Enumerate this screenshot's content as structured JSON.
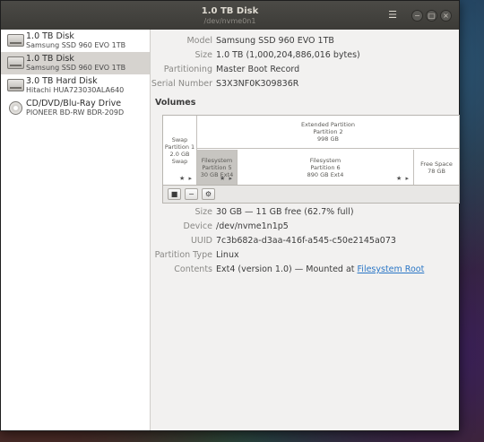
{
  "window": {
    "title": "1.0 TB Disk",
    "subtitle": "/dev/nvme0n1"
  },
  "sidebar": {
    "items": [
      {
        "name": "1.0 TB Disk",
        "sub": "Samsung SSD 960 EVO 1TB",
        "icon": "drive-icon",
        "selected": false
      },
      {
        "name": "1.0 TB Disk",
        "sub": "Samsung SSD 960 EVO 1TB",
        "icon": "drive-icon",
        "selected": true
      },
      {
        "name": "3.0 TB Hard Disk",
        "sub": "Hitachi HUA723030ALA640",
        "icon": "drive-icon",
        "selected": false
      },
      {
        "name": "CD/DVD/Blu-Ray Drive",
        "sub": "PIONEER BD-RW   BDR-209D",
        "icon": "optical-disc-icon",
        "selected": false
      }
    ]
  },
  "disk": {
    "model_label": "Model",
    "model": "Samsung SSD 960 EVO 1TB",
    "size_label": "Size",
    "size": "1.0 TB (1,000,204,886,016 bytes)",
    "partitioning_label": "Partitioning",
    "partitioning": "Master Boot Record",
    "serial_label": "Serial Number",
    "serial": "S3X3NF0K309836R"
  },
  "volumes": {
    "title": "Volumes",
    "swap": {
      "l1": "Swap",
      "l2": "Partition 1",
      "l3": "2.0 GB Swap"
    },
    "extended": {
      "l1": "Extended Partition",
      "l2": "Partition 2",
      "l3": "998 GB"
    },
    "fs5": {
      "l1": "Filesystem",
      "l2": "Partition 5",
      "l3": "30 GB Ext4"
    },
    "fs6": {
      "l1": "Filesystem",
      "l2": "Partition 6",
      "l3": "890 GB Ext4"
    },
    "free": {
      "l1": "Free Space",
      "l2": "78 GB"
    },
    "toolbar": {
      "stop": "■",
      "minus": "−",
      "gear": "⚙"
    }
  },
  "partition": {
    "size_label": "Size",
    "size": "30 GB — 11 GB free (62.7% full)",
    "device_label": "Device",
    "device": "/dev/nvme1n1p5",
    "uuid_label": "UUID",
    "uuid": "7c3b682a-d3aa-416f-a545-c50e2145a073",
    "type_label": "Partition Type",
    "type": "Linux",
    "contents_label": "Contents",
    "contents": "Ext4 (version 1.0) — Mounted at ",
    "mount_link": "Filesystem Root"
  }
}
